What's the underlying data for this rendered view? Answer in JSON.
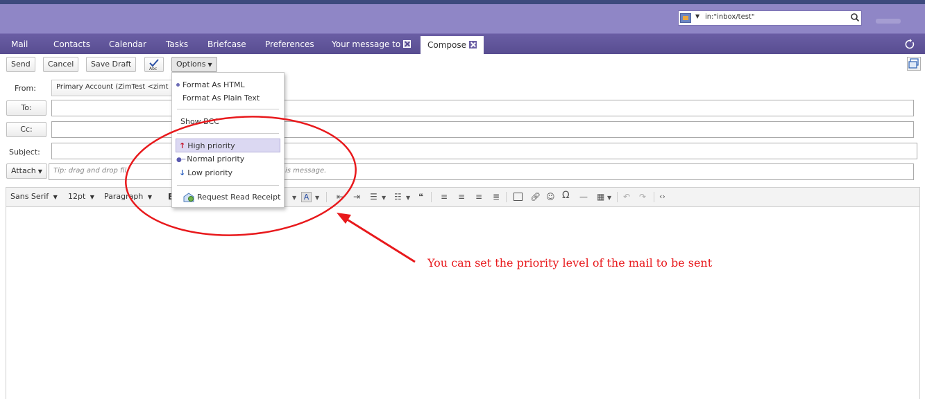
{
  "search": {
    "query": "in:\"inbox/test\""
  },
  "tabs": [
    {
      "label": "Mail"
    },
    {
      "label": "Contacts"
    },
    {
      "label": "Calendar"
    },
    {
      "label": "Tasks"
    },
    {
      "label": "Briefcase"
    },
    {
      "label": "Preferences"
    },
    {
      "label": "Your message to"
    },
    {
      "label": "Compose"
    }
  ],
  "toolbar": {
    "send": "Send",
    "cancel": "Cancel",
    "save_draft": "Save Draft",
    "options": "Options"
  },
  "compose": {
    "from_label": "From:",
    "from_value": "Primary Account (ZimTest <zimt",
    "to_label": "To:",
    "cc_label": "Cc:",
    "subject_label": "Subject:",
    "attach_label": "Attach",
    "attach_hint_start": "Tip: drag and drop fil",
    "attach_hint_end": "is message."
  },
  "editor": {
    "font_family": "Sans Serif",
    "font_size": "12pt",
    "block_format": "Paragraph",
    "bold": "B"
  },
  "options_menu": {
    "format_html": "Format As HTML",
    "format_plain": "Format As Plain Text",
    "show_bcc": "Show BCC",
    "high_priority": "High priority",
    "normal_priority": "Normal priority",
    "low_priority": "Low priority",
    "read_receipt": "Request Read Receipt"
  },
  "annotation": {
    "text": "You can set the priority level of the mail to be sent",
    "color": "#e8191c"
  },
  "icons": [
    "search-icon",
    "refresh-icon",
    "spell-check-icon",
    "detach-window-icon",
    "high-priority-icon",
    "low-priority-icon",
    "read-receipt-icon"
  ]
}
